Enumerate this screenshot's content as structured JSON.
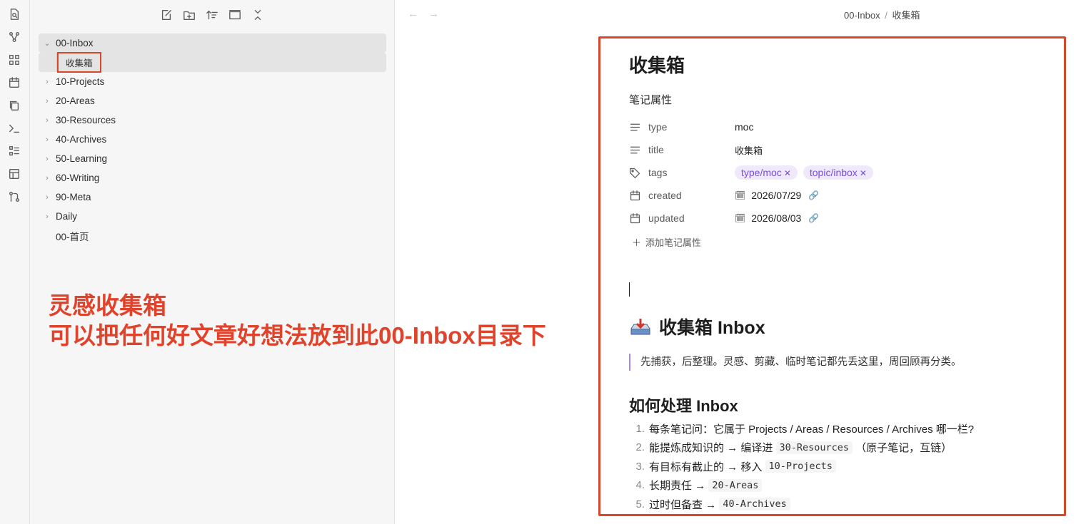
{
  "ribbon": {
    "icons": [
      "file-search-icon",
      "graph-icon",
      "grid-icon",
      "calendar-icon",
      "copy-icon",
      "terminal-icon",
      "checklist-icon",
      "layout-icon",
      "git-icon"
    ]
  },
  "sidebar": {
    "toolbar": [
      "new-note-icon",
      "new-folder-icon",
      "sort-icon",
      "collapse-icon",
      "collapse-all-icon"
    ],
    "tree": [
      {
        "label": "00-Inbox",
        "state": "open"
      },
      {
        "label": "收集箱",
        "state": "child"
      },
      {
        "label": "10-Projects",
        "state": "closed"
      },
      {
        "label": "20-Areas",
        "state": "closed"
      },
      {
        "label": "30-Resources",
        "state": "closed"
      },
      {
        "label": "40-Archives",
        "state": "closed"
      },
      {
        "label": "50-Learning",
        "state": "closed"
      },
      {
        "label": "60-Writing",
        "state": "closed"
      },
      {
        "label": "90-Meta",
        "state": "closed"
      },
      {
        "label": "Daily",
        "state": "closed"
      },
      {
        "label": "00-首页",
        "state": "leaf"
      }
    ]
  },
  "annotation": {
    "line1": "灵感收集箱",
    "line2": "可以把任何好文章好想法放到此00-Inbox目录下",
    "color": "#e0432b"
  },
  "topbar": {
    "back": "←",
    "forward": "→",
    "breadcrumb_folder": "00-Inbox",
    "breadcrumb_sep": "/",
    "breadcrumb_file": "收集箱"
  },
  "doc": {
    "title": "收集箱",
    "props_heading": "笔记属性",
    "properties": {
      "type": {
        "key": "type",
        "value": "moc"
      },
      "title": {
        "key": "title",
        "value": "收集箱"
      },
      "tags": {
        "key": "tags",
        "values": [
          "type/moc",
          "topic/inbox"
        ]
      },
      "created": {
        "key": "created",
        "value": "2026/07/29"
      },
      "updated": {
        "key": "updated",
        "value": "2026/08/03"
      }
    },
    "add_property": "添加笔记属性",
    "h1": "收集箱 Inbox",
    "quote": "先捕获，后整理。灵感、剪藏、临时笔记都先丢这里，周回顾再分类。",
    "h2": "如何处理 Inbox",
    "list": [
      {
        "num": "1.",
        "text": "每条笔记问：它属于 Projects / Areas / Resources / Archives 哪一栏?"
      },
      {
        "num": "2.",
        "text": "能提炼成知识的 → 编译进 ",
        "code": "30-Resources",
        "after": "（原子笔记，互链）"
      },
      {
        "num": "3.",
        "text": "有目标有截止的 → 移入 ",
        "code": "10-Projects"
      },
      {
        "num": "4.",
        "text": "长期责任 → ",
        "code": "20-Areas"
      },
      {
        "num": "5.",
        "text": "过时但备查 → ",
        "code": "40-Archives"
      }
    ]
  },
  "colors": {
    "accent": "#d9472b",
    "tag_bg": "#efe9fb",
    "tag_text": "#7a4fd6",
    "quote_border": "#a884ef"
  }
}
